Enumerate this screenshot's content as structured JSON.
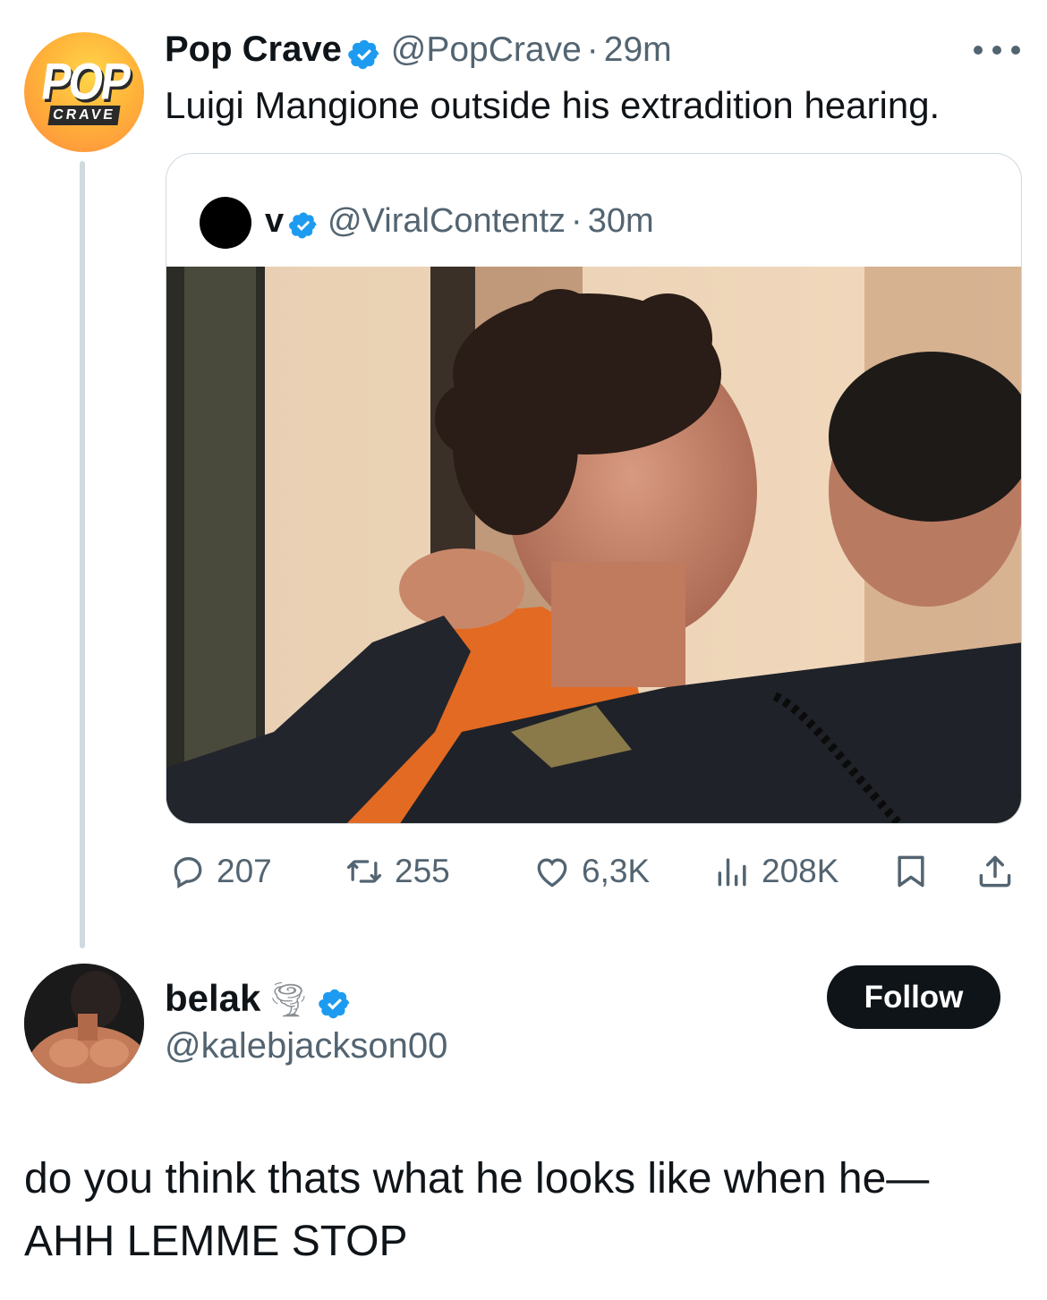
{
  "tweet": {
    "author_name": "Pop Crave",
    "author_handle": "@PopCrave",
    "separator": "·",
    "time": "29m",
    "text": "Luigi Mangione outside his extradition hearing.",
    "avatar_logo_top": "POP",
    "avatar_logo_bottom": "CRAVE",
    "verified_icon": "verified-badge",
    "quote": {
      "author_name": "v",
      "author_handle": "@ViralContentz",
      "separator": "·",
      "time": "30m"
    },
    "stats": {
      "replies": "207",
      "reposts": "255",
      "likes": "6,3K",
      "views": "208K"
    }
  },
  "reply": {
    "author_name": "belak",
    "author_emoji": "🌪",
    "author_handle": "@kalebjackson00",
    "follow_label": "Follow",
    "text_line1": "do you think thats what he looks like when he—",
    "text_line2": "AHH LEMME STOP"
  },
  "colors": {
    "text": "#0f1419",
    "muted": "#536471",
    "verified": "#1d9bf0",
    "border": "#cfd9de",
    "follow_bg": "#0f1419"
  }
}
